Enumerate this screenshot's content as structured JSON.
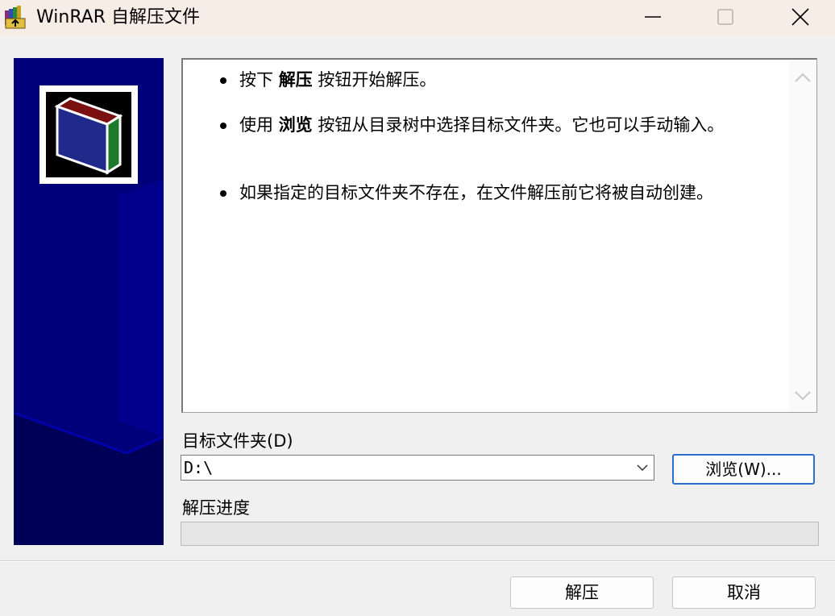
{
  "window": {
    "title": "WinRAR 自解压文件",
    "icons": {
      "app": "winrar-books-icon",
      "minimize": "minimize-icon",
      "maximize": "maximize-icon",
      "close": "close-icon"
    }
  },
  "info": {
    "items": [
      {
        "before": "按下 ",
        "bold": "解压",
        "after": " 按钮开始解压。"
      },
      {
        "before": "使用 ",
        "bold": "浏览",
        "after": " 按钮从目录树中选择目标文件夹。它也可以手动输入。"
      },
      {
        "before": "",
        "bold": "",
        "after": "如果指定的目标文件夹不存在，在文件解压前它将被自动创建。"
      }
    ]
  },
  "destination": {
    "label": "目标文件夹(D)",
    "value": "D:\\",
    "browse_label": "浏览(W)..."
  },
  "progress": {
    "label": "解压进度",
    "value": 0
  },
  "buttons": {
    "extract": "解压",
    "cancel": "取消"
  },
  "colors": {
    "side_panel": "#000066",
    "accent": "#2a6fcf"
  }
}
